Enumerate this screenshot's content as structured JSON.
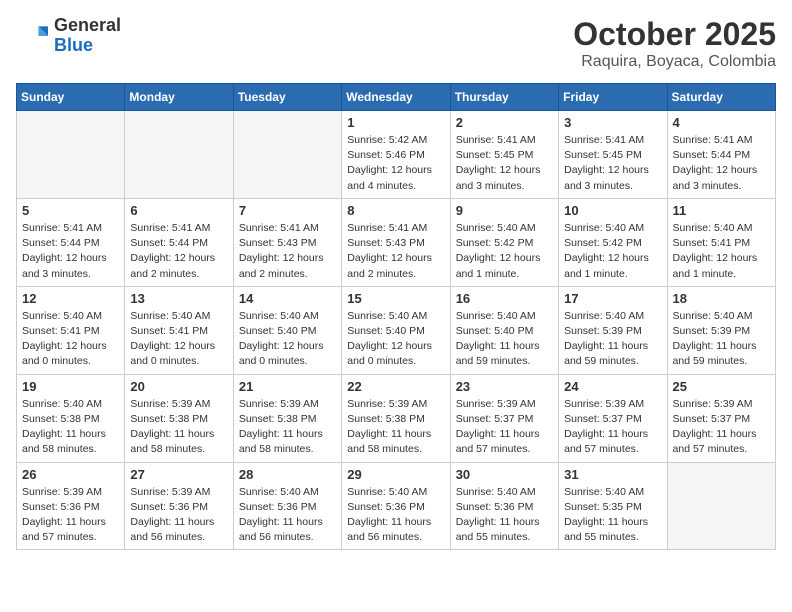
{
  "header": {
    "logo_general": "General",
    "logo_blue": "Blue",
    "month": "October 2025",
    "location": "Raquira, Boyaca, Colombia"
  },
  "weekdays": [
    "Sunday",
    "Monday",
    "Tuesday",
    "Wednesday",
    "Thursday",
    "Friday",
    "Saturday"
  ],
  "weeks": [
    [
      {
        "day": "",
        "info": ""
      },
      {
        "day": "",
        "info": ""
      },
      {
        "day": "",
        "info": ""
      },
      {
        "day": "1",
        "info": "Sunrise: 5:42 AM\nSunset: 5:46 PM\nDaylight: 12 hours\nand 4 minutes."
      },
      {
        "day": "2",
        "info": "Sunrise: 5:41 AM\nSunset: 5:45 PM\nDaylight: 12 hours\nand 3 minutes."
      },
      {
        "day": "3",
        "info": "Sunrise: 5:41 AM\nSunset: 5:45 PM\nDaylight: 12 hours\nand 3 minutes."
      },
      {
        "day": "4",
        "info": "Sunrise: 5:41 AM\nSunset: 5:44 PM\nDaylight: 12 hours\nand 3 minutes."
      }
    ],
    [
      {
        "day": "5",
        "info": "Sunrise: 5:41 AM\nSunset: 5:44 PM\nDaylight: 12 hours\nand 3 minutes."
      },
      {
        "day": "6",
        "info": "Sunrise: 5:41 AM\nSunset: 5:44 PM\nDaylight: 12 hours\nand 2 minutes."
      },
      {
        "day": "7",
        "info": "Sunrise: 5:41 AM\nSunset: 5:43 PM\nDaylight: 12 hours\nand 2 minutes."
      },
      {
        "day": "8",
        "info": "Sunrise: 5:41 AM\nSunset: 5:43 PM\nDaylight: 12 hours\nand 2 minutes."
      },
      {
        "day": "9",
        "info": "Sunrise: 5:40 AM\nSunset: 5:42 PM\nDaylight: 12 hours\nand 1 minute."
      },
      {
        "day": "10",
        "info": "Sunrise: 5:40 AM\nSunset: 5:42 PM\nDaylight: 12 hours\nand 1 minute."
      },
      {
        "day": "11",
        "info": "Sunrise: 5:40 AM\nSunset: 5:41 PM\nDaylight: 12 hours\nand 1 minute."
      }
    ],
    [
      {
        "day": "12",
        "info": "Sunrise: 5:40 AM\nSunset: 5:41 PM\nDaylight: 12 hours\nand 0 minutes."
      },
      {
        "day": "13",
        "info": "Sunrise: 5:40 AM\nSunset: 5:41 PM\nDaylight: 12 hours\nand 0 minutes."
      },
      {
        "day": "14",
        "info": "Sunrise: 5:40 AM\nSunset: 5:40 PM\nDaylight: 12 hours\nand 0 minutes."
      },
      {
        "day": "15",
        "info": "Sunrise: 5:40 AM\nSunset: 5:40 PM\nDaylight: 12 hours\nand 0 minutes."
      },
      {
        "day": "16",
        "info": "Sunrise: 5:40 AM\nSunset: 5:40 PM\nDaylight: 11 hours\nand 59 minutes."
      },
      {
        "day": "17",
        "info": "Sunrise: 5:40 AM\nSunset: 5:39 PM\nDaylight: 11 hours\nand 59 minutes."
      },
      {
        "day": "18",
        "info": "Sunrise: 5:40 AM\nSunset: 5:39 PM\nDaylight: 11 hours\nand 59 minutes."
      }
    ],
    [
      {
        "day": "19",
        "info": "Sunrise: 5:40 AM\nSunset: 5:38 PM\nDaylight: 11 hours\nand 58 minutes."
      },
      {
        "day": "20",
        "info": "Sunrise: 5:39 AM\nSunset: 5:38 PM\nDaylight: 11 hours\nand 58 minutes."
      },
      {
        "day": "21",
        "info": "Sunrise: 5:39 AM\nSunset: 5:38 PM\nDaylight: 11 hours\nand 58 minutes."
      },
      {
        "day": "22",
        "info": "Sunrise: 5:39 AM\nSunset: 5:38 PM\nDaylight: 11 hours\nand 58 minutes."
      },
      {
        "day": "23",
        "info": "Sunrise: 5:39 AM\nSunset: 5:37 PM\nDaylight: 11 hours\nand 57 minutes."
      },
      {
        "day": "24",
        "info": "Sunrise: 5:39 AM\nSunset: 5:37 PM\nDaylight: 11 hours\nand 57 minutes."
      },
      {
        "day": "25",
        "info": "Sunrise: 5:39 AM\nSunset: 5:37 PM\nDaylight: 11 hours\nand 57 minutes."
      }
    ],
    [
      {
        "day": "26",
        "info": "Sunrise: 5:39 AM\nSunset: 5:36 PM\nDaylight: 11 hours\nand 57 minutes."
      },
      {
        "day": "27",
        "info": "Sunrise: 5:39 AM\nSunset: 5:36 PM\nDaylight: 11 hours\nand 56 minutes."
      },
      {
        "day": "28",
        "info": "Sunrise: 5:40 AM\nSunset: 5:36 PM\nDaylight: 11 hours\nand 56 minutes."
      },
      {
        "day": "29",
        "info": "Sunrise: 5:40 AM\nSunset: 5:36 PM\nDaylight: 11 hours\nand 56 minutes."
      },
      {
        "day": "30",
        "info": "Sunrise: 5:40 AM\nSunset: 5:36 PM\nDaylight: 11 hours\nand 55 minutes."
      },
      {
        "day": "31",
        "info": "Sunrise: 5:40 AM\nSunset: 5:35 PM\nDaylight: 11 hours\nand 55 minutes."
      },
      {
        "day": "",
        "info": ""
      }
    ]
  ]
}
